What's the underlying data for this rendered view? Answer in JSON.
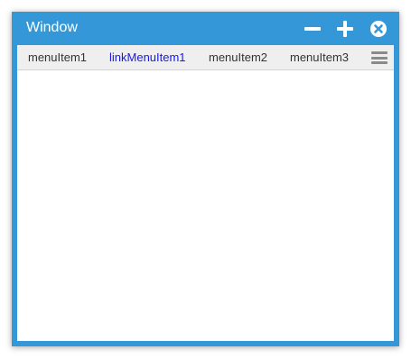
{
  "window": {
    "title": "Window",
    "controls": {
      "minimize_icon": "minus-icon",
      "maximize_icon": "plus-icon",
      "close_icon": "close-circle-icon"
    },
    "accent_color": "#3498d8"
  },
  "menubar": {
    "items": [
      {
        "label": "menuItem1",
        "type": "item"
      },
      {
        "label": "linkMenuItem1",
        "type": "link"
      },
      {
        "label": "menuItem2",
        "type": "item"
      },
      {
        "label": "menuItem3",
        "type": "item"
      }
    ],
    "overflow_icon": "hamburger-menu-icon",
    "link_color": "#1a1adc"
  }
}
